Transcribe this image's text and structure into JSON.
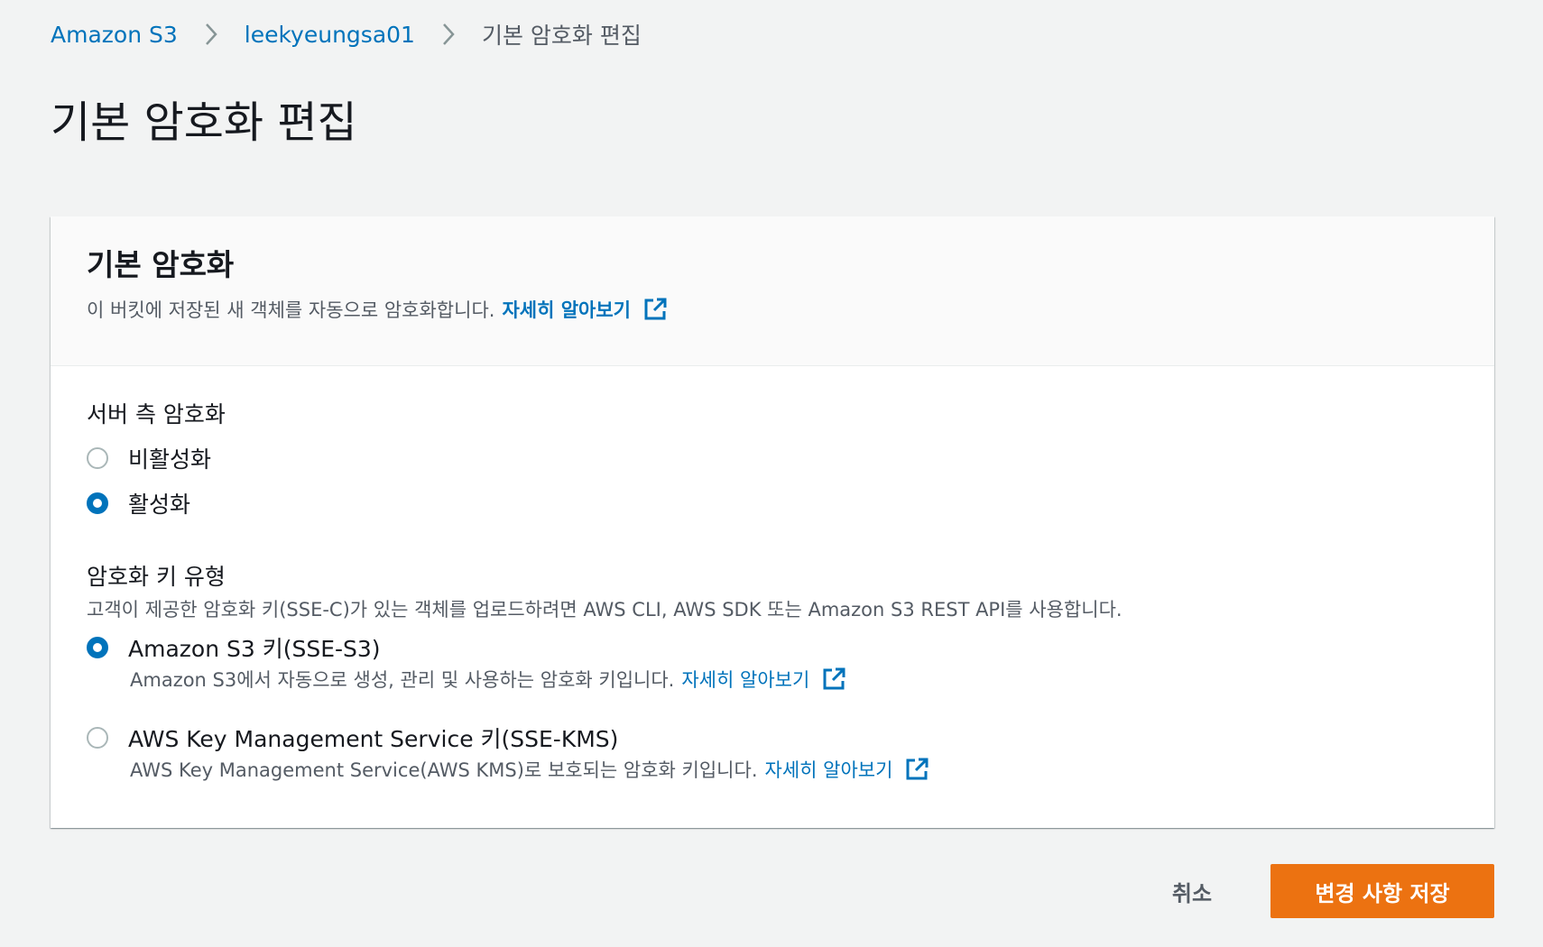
{
  "breadcrumb": {
    "items": [
      {
        "label": "Amazon S3"
      },
      {
        "label": "leekyeungsa01"
      },
      {
        "label": "기본 암호화 편집"
      }
    ]
  },
  "page": {
    "title": "기본 암호화 편집"
  },
  "panel": {
    "title": "기본 암호화",
    "description": "이 버킷에 저장된 새 객체를 자동으로 암호화합니다.",
    "learn_more": "자세히 알아보기"
  },
  "server_side": {
    "label": "서버 측 암호화",
    "options": [
      {
        "label": "비활성화",
        "checked": false
      },
      {
        "label": "활성화",
        "checked": true
      }
    ]
  },
  "key_type": {
    "label": "암호화 키 유형",
    "description": "고객이 제공한 암호화 키(SSE-C)가 있는 객체를 업로드하려면 AWS CLI, AWS SDK 또는 Amazon S3 REST API를 사용합니다.",
    "options": [
      {
        "label": "Amazon S3 키(SSE-S3)",
        "description": "Amazon S3에서 자동으로 생성, 관리 및 사용하는 암호화 키입니다.",
        "learn_more": "자세히 알아보기",
        "checked": true
      },
      {
        "label": "AWS Key Management Service 키(SSE-KMS)",
        "description": "AWS Key Management Service(AWS KMS)로 보호되는 암호화 키입니다.",
        "learn_more": "자세히 알아보기",
        "checked": false
      }
    ]
  },
  "footer": {
    "cancel_label": "취소",
    "save_label": "변경 사항 저장"
  },
  "colors": {
    "link": "#0073bb",
    "primary_button": "#ec7211",
    "background": "#f2f3f3"
  },
  "icons": [
    "chevron-right-icon",
    "external-link-icon"
  ]
}
